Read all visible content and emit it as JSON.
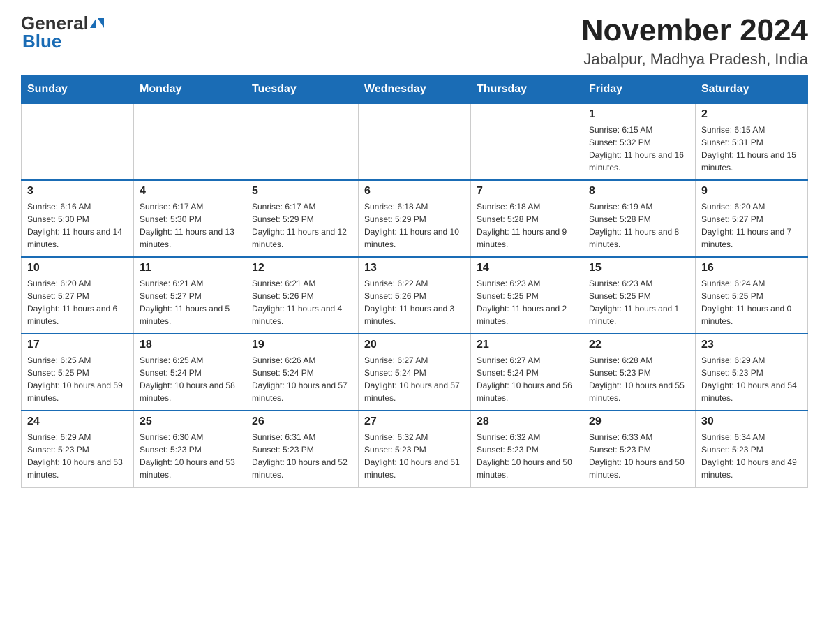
{
  "header": {
    "logo_general": "General",
    "logo_blue": "Blue",
    "title": "November 2024",
    "subtitle": "Jabalpur, Madhya Pradesh, India"
  },
  "calendar": {
    "days_of_week": [
      "Sunday",
      "Monday",
      "Tuesday",
      "Wednesday",
      "Thursday",
      "Friday",
      "Saturday"
    ],
    "weeks": [
      [
        {
          "day": "",
          "info": ""
        },
        {
          "day": "",
          "info": ""
        },
        {
          "day": "",
          "info": ""
        },
        {
          "day": "",
          "info": ""
        },
        {
          "day": "",
          "info": ""
        },
        {
          "day": "1",
          "info": "Sunrise: 6:15 AM\nSunset: 5:32 PM\nDaylight: 11 hours and 16 minutes."
        },
        {
          "day": "2",
          "info": "Sunrise: 6:15 AM\nSunset: 5:31 PM\nDaylight: 11 hours and 15 minutes."
        }
      ],
      [
        {
          "day": "3",
          "info": "Sunrise: 6:16 AM\nSunset: 5:30 PM\nDaylight: 11 hours and 14 minutes."
        },
        {
          "day": "4",
          "info": "Sunrise: 6:17 AM\nSunset: 5:30 PM\nDaylight: 11 hours and 13 minutes."
        },
        {
          "day": "5",
          "info": "Sunrise: 6:17 AM\nSunset: 5:29 PM\nDaylight: 11 hours and 12 minutes."
        },
        {
          "day": "6",
          "info": "Sunrise: 6:18 AM\nSunset: 5:29 PM\nDaylight: 11 hours and 10 minutes."
        },
        {
          "day": "7",
          "info": "Sunrise: 6:18 AM\nSunset: 5:28 PM\nDaylight: 11 hours and 9 minutes."
        },
        {
          "day": "8",
          "info": "Sunrise: 6:19 AM\nSunset: 5:28 PM\nDaylight: 11 hours and 8 minutes."
        },
        {
          "day": "9",
          "info": "Sunrise: 6:20 AM\nSunset: 5:27 PM\nDaylight: 11 hours and 7 minutes."
        }
      ],
      [
        {
          "day": "10",
          "info": "Sunrise: 6:20 AM\nSunset: 5:27 PM\nDaylight: 11 hours and 6 minutes."
        },
        {
          "day": "11",
          "info": "Sunrise: 6:21 AM\nSunset: 5:27 PM\nDaylight: 11 hours and 5 minutes."
        },
        {
          "day": "12",
          "info": "Sunrise: 6:21 AM\nSunset: 5:26 PM\nDaylight: 11 hours and 4 minutes."
        },
        {
          "day": "13",
          "info": "Sunrise: 6:22 AM\nSunset: 5:26 PM\nDaylight: 11 hours and 3 minutes."
        },
        {
          "day": "14",
          "info": "Sunrise: 6:23 AM\nSunset: 5:25 PM\nDaylight: 11 hours and 2 minutes."
        },
        {
          "day": "15",
          "info": "Sunrise: 6:23 AM\nSunset: 5:25 PM\nDaylight: 11 hours and 1 minute."
        },
        {
          "day": "16",
          "info": "Sunrise: 6:24 AM\nSunset: 5:25 PM\nDaylight: 11 hours and 0 minutes."
        }
      ],
      [
        {
          "day": "17",
          "info": "Sunrise: 6:25 AM\nSunset: 5:25 PM\nDaylight: 10 hours and 59 minutes."
        },
        {
          "day": "18",
          "info": "Sunrise: 6:25 AM\nSunset: 5:24 PM\nDaylight: 10 hours and 58 minutes."
        },
        {
          "day": "19",
          "info": "Sunrise: 6:26 AM\nSunset: 5:24 PM\nDaylight: 10 hours and 57 minutes."
        },
        {
          "day": "20",
          "info": "Sunrise: 6:27 AM\nSunset: 5:24 PM\nDaylight: 10 hours and 57 minutes."
        },
        {
          "day": "21",
          "info": "Sunrise: 6:27 AM\nSunset: 5:24 PM\nDaylight: 10 hours and 56 minutes."
        },
        {
          "day": "22",
          "info": "Sunrise: 6:28 AM\nSunset: 5:23 PM\nDaylight: 10 hours and 55 minutes."
        },
        {
          "day": "23",
          "info": "Sunrise: 6:29 AM\nSunset: 5:23 PM\nDaylight: 10 hours and 54 minutes."
        }
      ],
      [
        {
          "day": "24",
          "info": "Sunrise: 6:29 AM\nSunset: 5:23 PM\nDaylight: 10 hours and 53 minutes."
        },
        {
          "day": "25",
          "info": "Sunrise: 6:30 AM\nSunset: 5:23 PM\nDaylight: 10 hours and 53 minutes."
        },
        {
          "day": "26",
          "info": "Sunrise: 6:31 AM\nSunset: 5:23 PM\nDaylight: 10 hours and 52 minutes."
        },
        {
          "day": "27",
          "info": "Sunrise: 6:32 AM\nSunset: 5:23 PM\nDaylight: 10 hours and 51 minutes."
        },
        {
          "day": "28",
          "info": "Sunrise: 6:32 AM\nSunset: 5:23 PM\nDaylight: 10 hours and 50 minutes."
        },
        {
          "day": "29",
          "info": "Sunrise: 6:33 AM\nSunset: 5:23 PM\nDaylight: 10 hours and 50 minutes."
        },
        {
          "day": "30",
          "info": "Sunrise: 6:34 AM\nSunset: 5:23 PM\nDaylight: 10 hours and 49 minutes."
        }
      ]
    ]
  }
}
